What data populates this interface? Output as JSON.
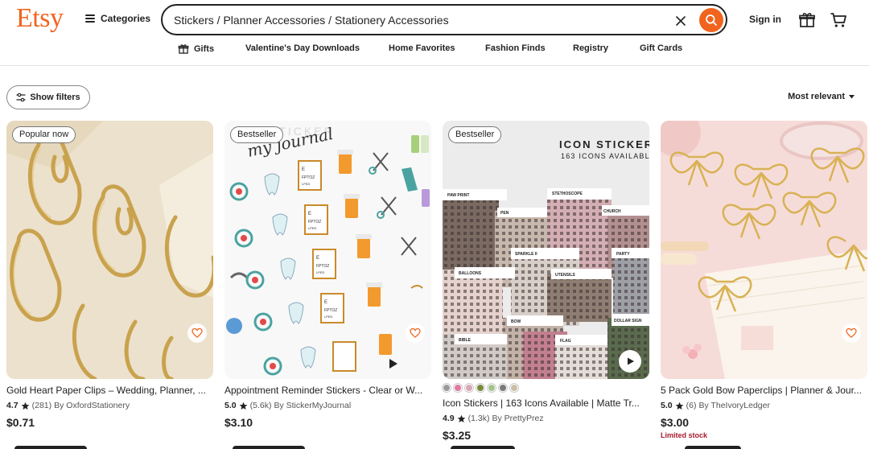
{
  "header": {
    "logo": "Etsy",
    "categories_label": "Categories",
    "search_value": "Stickers / Planner Accessories / Stationery Accessories",
    "sign_in_label": "Sign in"
  },
  "nav": {
    "items": [
      "Gifts",
      "Valentine's Day Downloads",
      "Home Favorites",
      "Fashion Finds",
      "Registry",
      "Gift Cards"
    ]
  },
  "toolbar": {
    "filters_label": "Show filters",
    "sort_label": "Most relevant"
  },
  "colors": {
    "brand": "#f1641e",
    "limited_stock": "#a61a2e"
  },
  "listings": [
    {
      "badge": "Popular now",
      "title": "Gold Heart Paper Clips – Wedding, Planner, ...",
      "rating": "4.7",
      "reviews": "(281)",
      "shop": "By OxfordStationery",
      "price": "$0.71",
      "image_text": []
    },
    {
      "badge": "Bestseller",
      "title": "Appointment Reminder Stickers - Clear or W...",
      "rating": "5.0",
      "reviews": "(5.6k)",
      "shop": "By StickerMyJournal",
      "price": "$3.10",
      "image_text": [
        "my journal",
        "STICKER"
      ]
    },
    {
      "badge": "Bestseller",
      "title": "Icon Stickers | 163 Icons Available | Matte Tr...",
      "rating": "4.9",
      "reviews": "(1.3k)",
      "shop": "By PrettyPrez",
      "price": "$3.25",
      "swatch_colors": [
        "#9a9a9a",
        "#e07aa0",
        "#d9a7b5",
        "#7b8a3a",
        "#a3c48b",
        "#7a7a7a",
        "#c9c0a8"
      ],
      "image_text": [
        "ICON STICKER",
        "163 ICONS AVAILABL",
        "PAW PRINT",
        "PEN",
        "STETHOSCOPE",
        "CHURCH",
        "SPARKLE II",
        "PARTY",
        "BALLOONS",
        "UTENSILS",
        "BOW",
        "DOLLAR SIGN",
        "BIBLE",
        "FLAG"
      ]
    },
    {
      "badge": "",
      "title": "5 Pack Gold Bow Paperclips | Planner & Jour...",
      "rating": "5.0",
      "reviews": "(6)",
      "shop": "By TheIvoryLedger",
      "price": "$3.00",
      "stock_note": "Limited stock",
      "image_text": []
    }
  ]
}
